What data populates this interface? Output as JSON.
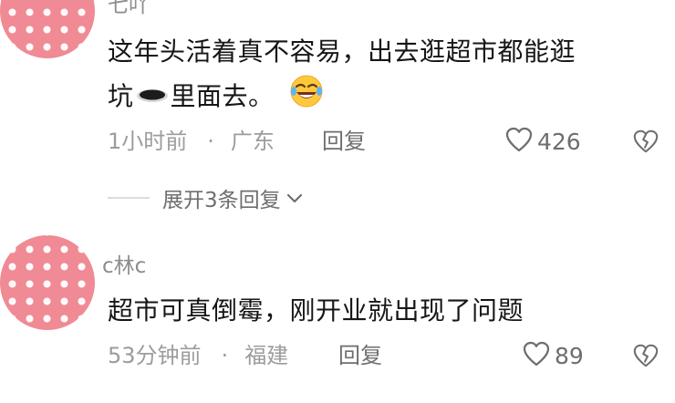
{
  "comments": [
    {
      "username": "七吖",
      "text_line1": "这年头活着真不容易，出去逛超市都能逛",
      "text_line2_a": "坑",
      "text_line2_b": "里面去。",
      "time": "1小时前",
      "separator": "·",
      "location": "广东",
      "reply_label": "回复",
      "like_count": "426",
      "expand_label": "展开3条回复"
    },
    {
      "username": "c林c",
      "text": "超市可真倒霉，刚开业就出现了问题",
      "time": "53分钟前",
      "separator": "·",
      "location": "福建",
      "reply_label": "回复",
      "like_count": "89"
    }
  ],
  "icons": {
    "hole": "hole-emoji-icon",
    "laugh": "rolling-laugh-emoji-icon",
    "heart": "heart-outline-icon",
    "dislike": "broken-heart-outline-icon",
    "expand": "chevron-down-icon"
  }
}
